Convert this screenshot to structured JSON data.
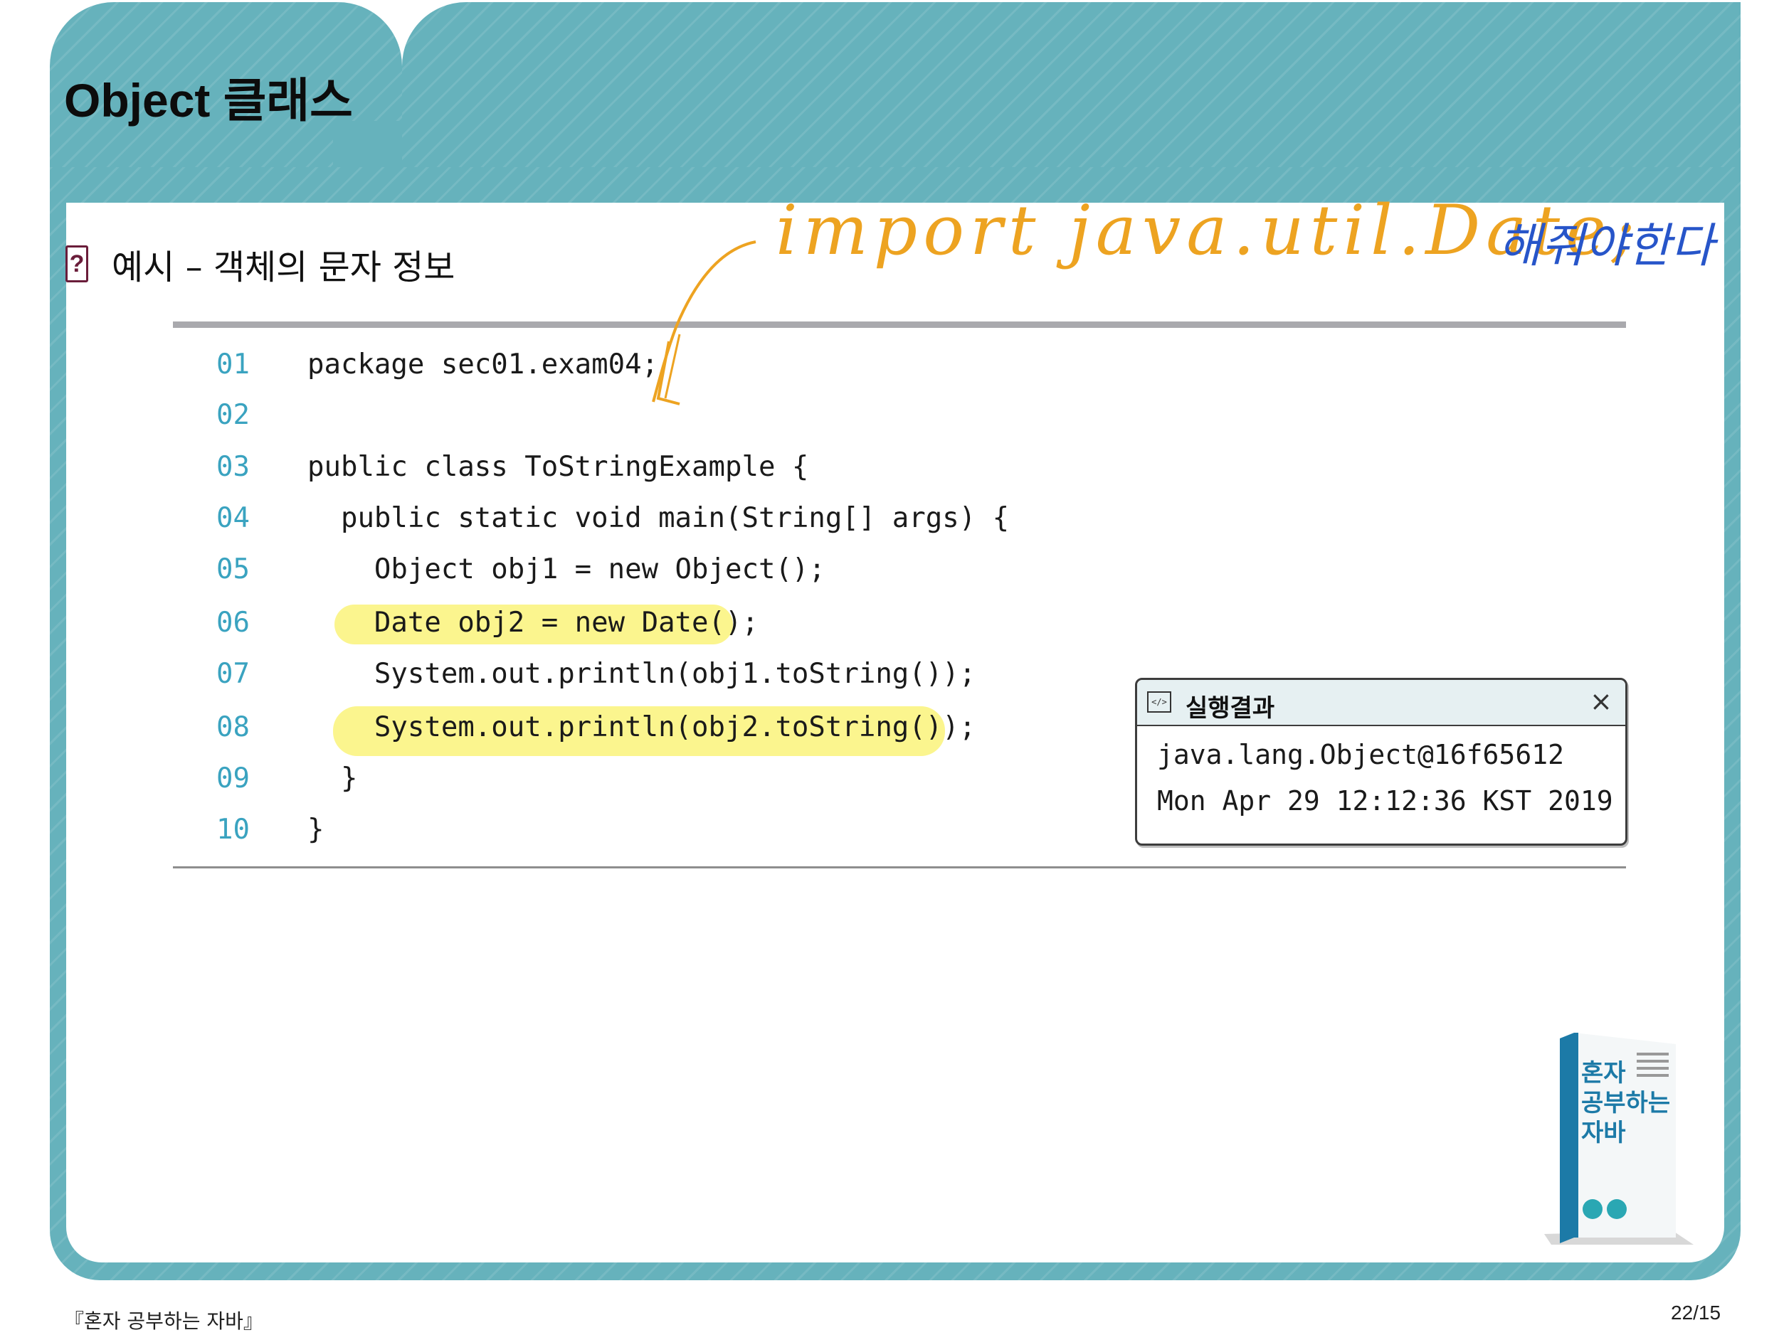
{
  "slide": {
    "title": "Object 클래스",
    "subtitle": "예시 – 객체의 문자 정보",
    "subtitle_icon": "?",
    "colors": {
      "header": "#66b2bc",
      "accent_line_numbers": "#3aa3c0",
      "highlight": "#fbf58e",
      "handwriting_orange": "#eda321",
      "handwriting_blue": "#2755c9"
    }
  },
  "code": {
    "lines": [
      {
        "num": "01",
        "text": "package sec01.exam04;"
      },
      {
        "num": "02",
        "text": ""
      },
      {
        "num": "03",
        "text": "public class ToStringExample {"
      },
      {
        "num": "04",
        "text": "  public static void main(String[] args) {"
      },
      {
        "num": "05",
        "text": "    Object obj1 = new Object();"
      },
      {
        "num": "06",
        "text": "    Date obj2 = new Date();"
      },
      {
        "num": "07",
        "text": "    System.out.println(obj1.toString());"
      },
      {
        "num": "08",
        "text": "    System.out.println(obj2.toString());"
      },
      {
        "num": "09",
        "text": "  }"
      },
      {
        "num": "10",
        "text": "}"
      }
    ],
    "highlighted_lines": [
      "06",
      "08"
    ]
  },
  "result_panel": {
    "icon": "code-window-icon",
    "icon_glyph": "</>",
    "title": "실행결과",
    "close": "×",
    "output": [
      "java.lang.Object@16f65612",
      "Mon Apr 29 12:12:36 KST 2019"
    ]
  },
  "annotations": {
    "handwritten_orange": "import java.util.Date;",
    "handwritten_blue": "해줘야한다"
  },
  "book": {
    "title_lines": [
      "혼자",
      "공부하는",
      "자바"
    ]
  },
  "footer": {
    "left": "『혼자 공부하는 자바』",
    "right": "22/15"
  }
}
